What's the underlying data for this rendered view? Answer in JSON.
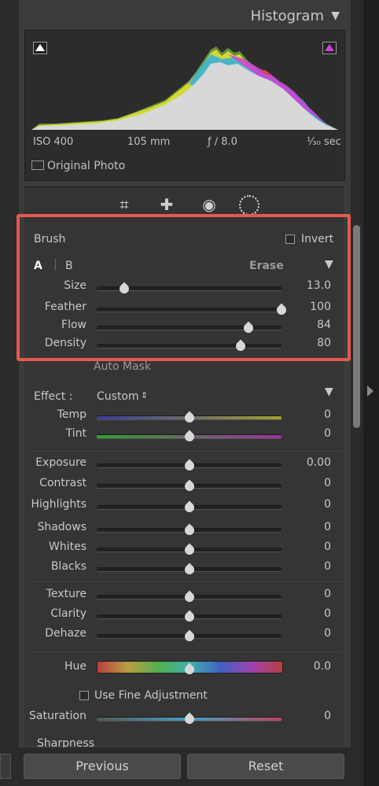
{
  "histogram": {
    "title": "Histogram",
    "exif": {
      "iso": "ISO 400",
      "focal": "105 mm",
      "aperture": "ƒ / 8.0",
      "shutter": "¹⁄₃₀ sec"
    },
    "original_photo_label": "Original Photo"
  },
  "tools": [
    "crop-icon",
    "healing-icon",
    "red-eye-icon",
    "mask-icon"
  ],
  "brush": {
    "title": "Brush",
    "invert_label": "Invert",
    "tab_a": "A",
    "tab_b": "B",
    "erase_label": "Erase",
    "auto_mask_label": "Auto Mask",
    "sliders": [
      {
        "label": "Size",
        "value": "13.0",
        "fraction": 0.15
      },
      {
        "label": "Feather",
        "value": "100",
        "fraction": 1.0
      },
      {
        "label": "Flow",
        "value": "84",
        "fraction": 0.82
      },
      {
        "label": "Density",
        "value": "80",
        "fraction": 0.78
      }
    ]
  },
  "effect": {
    "label": "Effect :",
    "preset": "Custom",
    "temp": {
      "label": "Temp",
      "value": "0"
    },
    "tint": {
      "label": "Tint",
      "value": "0"
    },
    "tone": [
      {
        "label": "Exposure",
        "value": "0.00"
      },
      {
        "label": "Contrast",
        "value": "0"
      },
      {
        "label": "Highlights",
        "value": "0"
      },
      {
        "label": "Shadows",
        "value": "0"
      },
      {
        "label": "Whites",
        "value": "0"
      },
      {
        "label": "Blacks",
        "value": "0"
      }
    ],
    "presence": [
      {
        "label": "Texture",
        "value": "0"
      },
      {
        "label": "Clarity",
        "value": "0"
      },
      {
        "label": "Dehaze",
        "value": "0"
      }
    ],
    "hue": {
      "label": "Hue",
      "value": "0.0"
    },
    "fine_adjust_label": "Use Fine Adjustment",
    "saturation": {
      "label": "Saturation",
      "value": "0"
    },
    "sharpness_label": "Sharpness"
  },
  "buttons": {
    "previous": "Previous",
    "reset": "Reset"
  },
  "colors": {
    "highlight_border": "#e8584f",
    "panel_bg": "#3b3b3b"
  }
}
